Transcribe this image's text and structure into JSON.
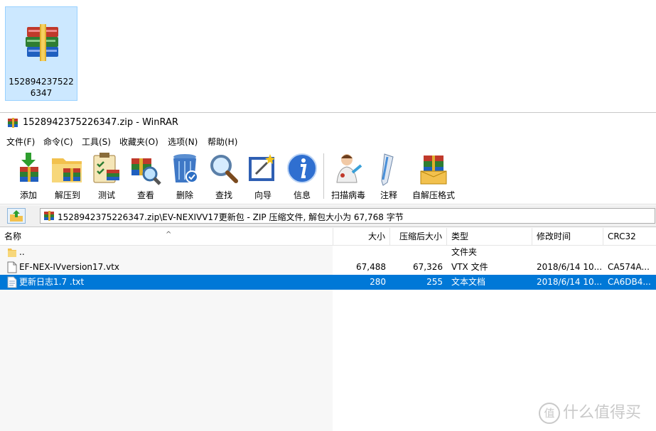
{
  "desktop_icon": {
    "label": "1528942375226347",
    "icon": "winrar-archive-icon"
  },
  "window": {
    "title": "1528942375226347.zip - WinRAR",
    "menu": [
      "文件(F)",
      "命令(C)",
      "工具(S)",
      "收藏夹(O)",
      "选项(N)",
      "帮助(H)"
    ],
    "toolbar": [
      {
        "label": "添加",
        "icon": "add-icon"
      },
      {
        "label": "解压到",
        "icon": "extract-to-icon"
      },
      {
        "label": "测试",
        "icon": "test-icon"
      },
      {
        "label": "查看",
        "icon": "view-icon"
      },
      {
        "label": "删除",
        "icon": "delete-icon"
      },
      {
        "label": "查找",
        "icon": "find-icon"
      },
      {
        "label": "向导",
        "icon": "wizard-icon"
      },
      {
        "label": "信息",
        "icon": "info-icon"
      },
      {
        "label": "扫描病毒",
        "icon": "scan-virus-icon"
      },
      {
        "label": "注释",
        "icon": "comment-icon"
      },
      {
        "label": "自解压格式",
        "icon": "sfx-icon"
      }
    ],
    "address": "1528942375226347.zip\\EV-NEXIVV17更新包 - ZIP 压缩文件, 解包大小为 67,768 字节",
    "columns": {
      "name": "名称",
      "size": "大小",
      "packed": "压缩后大小",
      "type": "类型",
      "modified": "修改时间",
      "crc": "CRC32"
    },
    "files": [
      {
        "name": "..",
        "size": "",
        "packed": "",
        "type": "文件夹",
        "modified": "",
        "crc": "",
        "icon": "folder-icon",
        "selected": false
      },
      {
        "name": "EF-NEX-IVversion17.vtx",
        "size": "67,488",
        "packed": "67,326",
        "type": "VTX 文件",
        "modified": "2018/6/14 10...",
        "crc": "CA574A...",
        "icon": "file-icon",
        "selected": false
      },
      {
        "name": "更新日志1.7 .txt",
        "size": "280",
        "packed": "255",
        "type": "文本文档",
        "modified": "2018/6/14 10...",
        "crc": "CA6DB4...",
        "icon": "text-file-icon",
        "selected": true
      }
    ]
  },
  "watermark": {
    "circle": "值",
    "text": "什么值得买"
  }
}
